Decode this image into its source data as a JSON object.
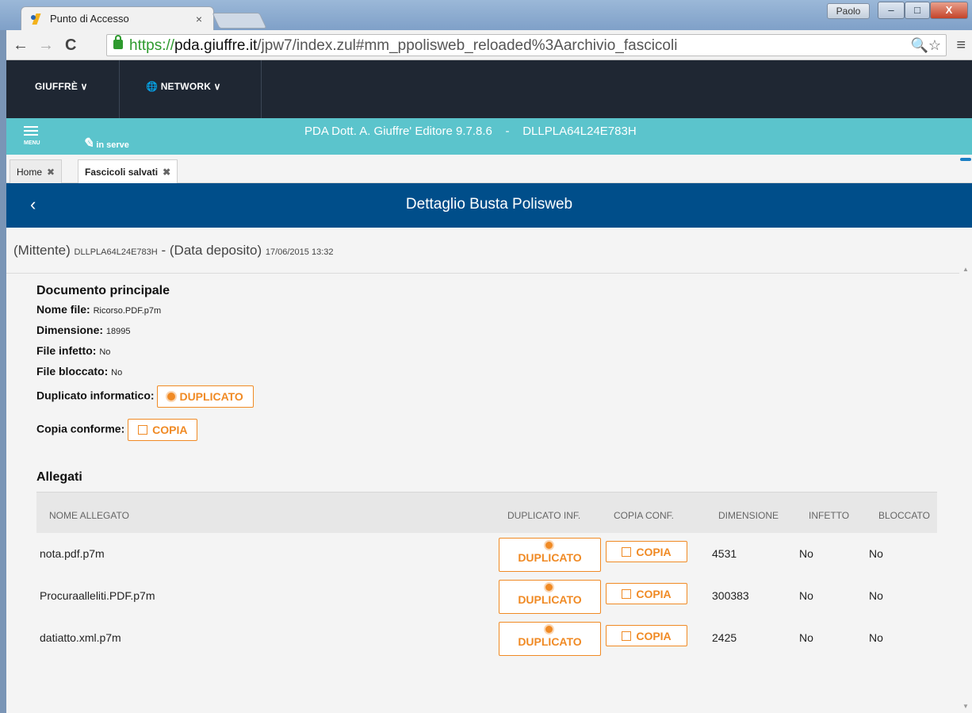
{
  "browser": {
    "tab_title": "Punto di Accesso",
    "tab_close": "×",
    "user": "Paolo",
    "win_min": "–",
    "win_max": "□",
    "win_close": "X",
    "url_scheme": "https://",
    "url_host": "pda.giuffre.it",
    "url_path": "/jpw7/index.zul#mm_ppolisweb_reloaded%3Aarchivio_fascicoli",
    "back": "←",
    "forward": "→",
    "reload": "C",
    "omni_icons": "🔍☆",
    "menu": "≡"
  },
  "topnav": {
    "giuffre": "GIUFFRÈ ∨",
    "network": "NETWORK ∨"
  },
  "header": {
    "menu_label": "MENU",
    "serve_label": "in serve",
    "title": "PDA Dott. A. Giuffre' Editore 9.7.8.6    -    DLLPLA64L24E783H"
  },
  "tabs": [
    {
      "label": "Home",
      "close": "✖"
    },
    {
      "label": "Fascicoli salvati",
      "close": "✖"
    }
  ],
  "page": {
    "back": "‹",
    "title": "Dettaglio Busta Polisweb",
    "mittente_label": "(Mittente)",
    "mittente_value": "DLLPLA64L24E783H",
    "dash": "-",
    "data_label": "(Data deposito)",
    "data_value": "17/06/2015 13:32"
  },
  "documento": {
    "heading": "Documento principale",
    "nome_file_label": "Nome file:",
    "nome_file_value": "Ricorso.PDF.p7m",
    "dimensione_label": "Dimensione:",
    "dimensione_value": "18995",
    "infetto_label": "File infetto:",
    "infetto_value": "No",
    "bloccato_label": "File bloccato:",
    "bloccato_value": "No",
    "duplicato_label": "Duplicato informatico:",
    "duplicato_btn": "DUPLICATO",
    "copia_label": "Copia conforme:",
    "copia_btn": "COPIA"
  },
  "allegati": {
    "heading": "Allegati",
    "columns": [
      "NOME ALLEGATO",
      "DUPLICATO INF.",
      "COPIA CONF.",
      "DIMENSIONE",
      "INFETTO",
      "BLOCCATO"
    ],
    "rows": [
      {
        "nome": "nota.pdf.p7m",
        "dup": "DUPLICATO",
        "copia": "COPIA",
        "dimensione": "4531",
        "infetto": "No",
        "bloccato": "No"
      },
      {
        "nome": "Procuraalleliti.PDF.p7m",
        "dup": "DUPLICATO",
        "copia": "COPIA",
        "dimensione": "300383",
        "infetto": "No",
        "bloccato": "No"
      },
      {
        "nome": "datiatto.xml.p7m",
        "dup": "DUPLICATO",
        "copia": "COPIA",
        "dimensione": "2425",
        "infetto": "No",
        "bloccato": "No"
      }
    ]
  },
  "colors": {
    "accent_orange": "#f08a24",
    "teal": "#5bc4cc",
    "blue_band": "#004e8a",
    "dark_nav": "#1f2733"
  }
}
